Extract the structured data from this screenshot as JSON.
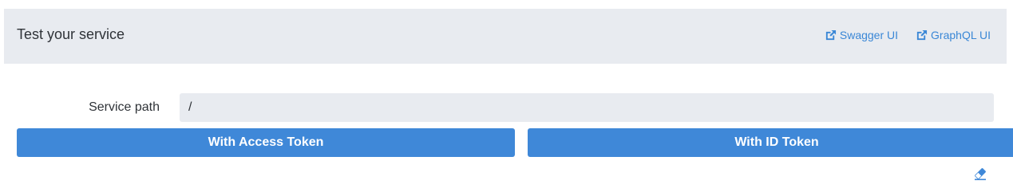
{
  "panel": {
    "title": "Test your service",
    "links": [
      {
        "label": "Swagger UI",
        "icon": "external-link-icon"
      },
      {
        "label": "GraphQL UI",
        "icon": "external-link-icon"
      }
    ]
  },
  "form": {
    "service_path_label": "Service path",
    "service_path_value": "/"
  },
  "buttons": {
    "access_token_label": "With Access Token",
    "id_token_label": "With ID Token"
  },
  "icons": {
    "clear": "eraser-icon"
  },
  "colors": {
    "accent": "#3f88d8",
    "link": "#3a87d6",
    "header_bg": "#e8ebf0"
  }
}
